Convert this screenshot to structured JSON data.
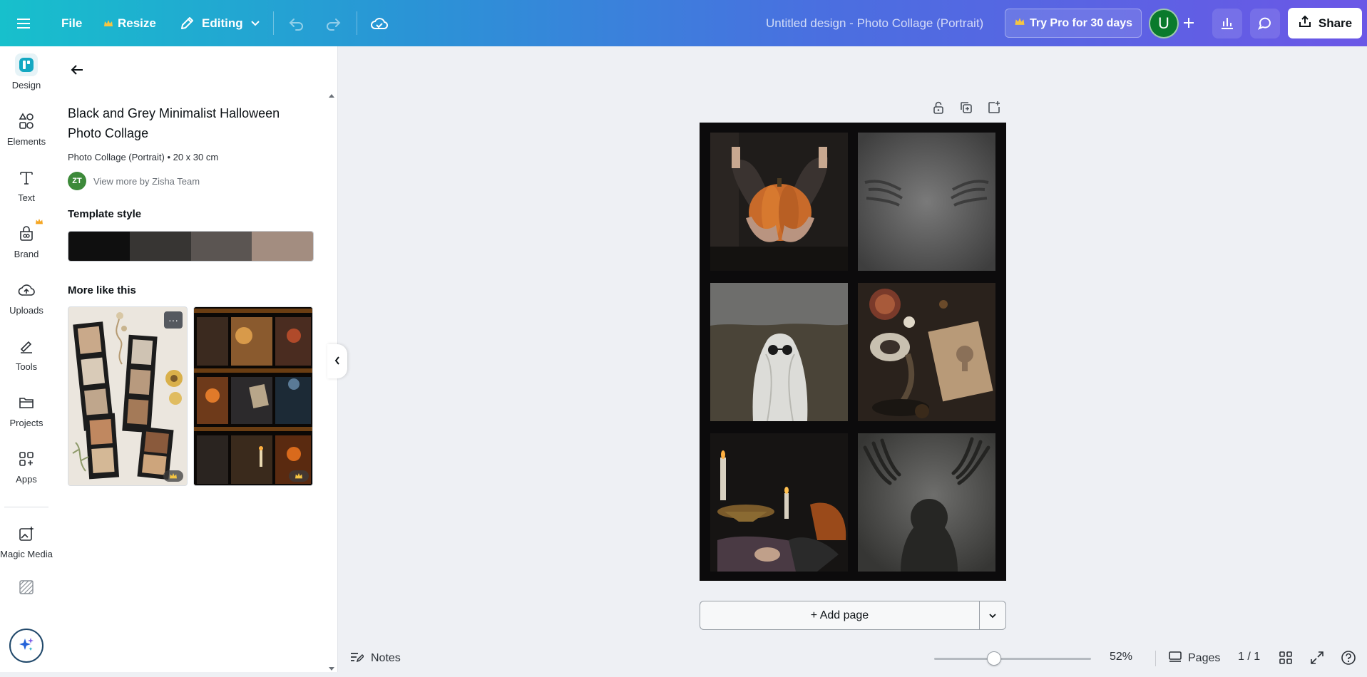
{
  "topbar": {
    "file_label": "File",
    "resize_label": "Resize",
    "editing_label": "Editing",
    "doc_title": "Untitled design - Photo Collage (Portrait)",
    "pro_label": "Try Pro for 30 days",
    "avatar_initial": "U",
    "share_label": "Share"
  },
  "rail": {
    "items": [
      {
        "label": "Design",
        "icon": "design-icon"
      },
      {
        "label": "Elements",
        "icon": "elements-icon"
      },
      {
        "label": "Text",
        "icon": "text-icon"
      },
      {
        "label": "Brand",
        "icon": "brand-icon"
      },
      {
        "label": "Uploads",
        "icon": "uploads-icon"
      },
      {
        "label": "Tools",
        "icon": "tools-icon"
      },
      {
        "label": "Projects",
        "icon": "projects-icon"
      },
      {
        "label": "Apps",
        "icon": "apps-icon"
      },
      {
        "label": "Magic Media",
        "icon": "magic-media-icon"
      }
    ]
  },
  "panel": {
    "template_title": "Black and Grey Minimalist Halloween Photo Collage",
    "template_meta": "Photo Collage (Portrait) • 20 x 30 cm",
    "creator_initials": "ZT",
    "creator_link": "View more by Zisha Team",
    "style_heading": "Template style",
    "palette": [
      "#0f0f0f",
      "#373533",
      "#5b5552",
      "#a38d80"
    ],
    "more_heading": "More like this",
    "thumb_more": "···"
  },
  "canvas": {
    "add_page_label": "+ Add page"
  },
  "bottombar": {
    "notes_label": "Notes",
    "zoom": "52%",
    "zoom_fraction": 0.38,
    "pages_label": "Pages",
    "page_count": "1 / 1"
  },
  "colors": {
    "accent": "#00c4cc",
    "brand_gradient_start": "#17c0cc",
    "brand_gradient_end": "#6b57e6",
    "crown": "#f5a623"
  }
}
